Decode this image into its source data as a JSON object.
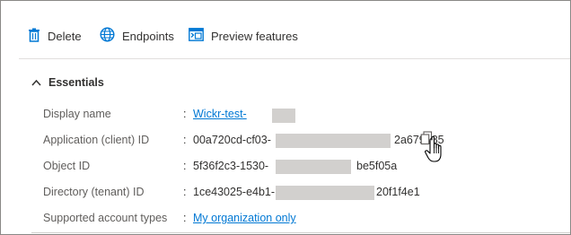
{
  "toolbar": {
    "delete_label": "Delete",
    "endpoints_label": "Endpoints",
    "preview_label": "Preview features"
  },
  "essentials": {
    "title": "Essentials"
  },
  "fields": {
    "display_name": {
      "label": "Display name",
      "value": "Wickr-test-"
    },
    "app_id": {
      "label": "Application (client) ID",
      "value_start": "00a720cd-cf03-",
      "value_end": "2a679b85"
    },
    "object_id": {
      "label": "Object ID",
      "value_start": "5f36f2c3-1530-",
      "value_end": "be5f05a"
    },
    "tenant_id": {
      "label": "Directory (tenant) ID",
      "value_start": "1ce43025-e4b1-",
      "value_end": "20f1f4e1"
    },
    "account_types": {
      "label": "Supported account types",
      "value": "My organization only"
    }
  },
  "colon": ":",
  "colors": {
    "accent": "#0078d4",
    "text": "#323130",
    "label": "#605e5c",
    "redaction": "#d2d0ce"
  },
  "icons": {
    "delete": "trash-icon",
    "endpoints": "globe-icon",
    "preview": "preview-features-icon",
    "essentials": "chevron-up-icon",
    "copy": "copy-icon",
    "cursor": "hand-pointer-cursor-icon"
  }
}
